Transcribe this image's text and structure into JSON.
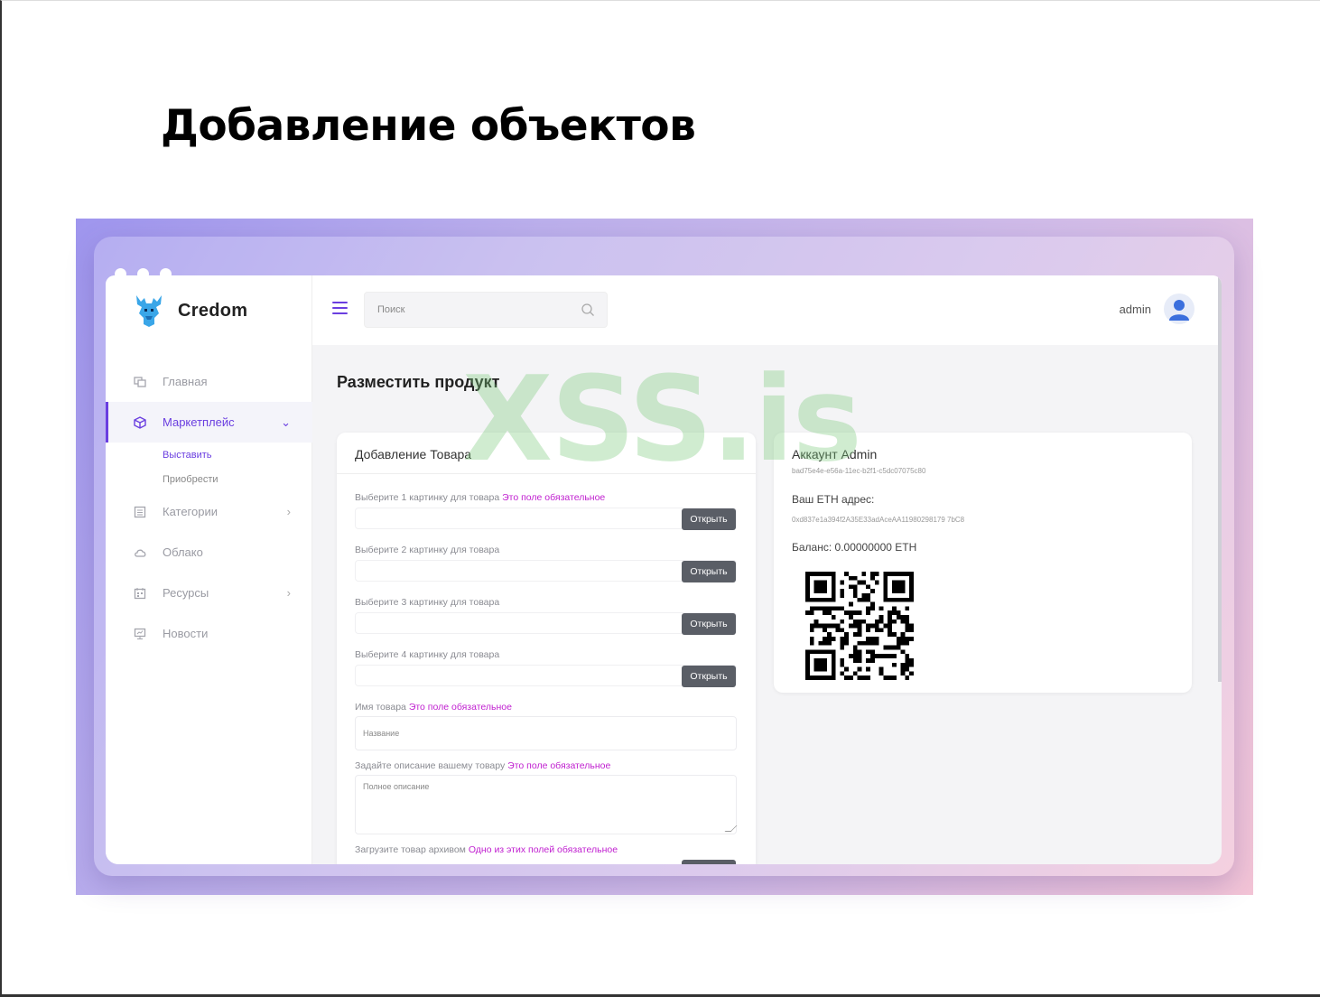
{
  "slide": {
    "title": "Добавление объектов"
  },
  "app": {
    "brand": "Credom",
    "sidebar": {
      "items": [
        {
          "label": "Главная",
          "icon": "home-icon"
        },
        {
          "label": "Маркетплейс",
          "icon": "cube-icon",
          "active": true,
          "expanded": true,
          "children": [
            {
              "label": "Выставить",
              "active": true
            },
            {
              "label": "Приобрести"
            }
          ]
        },
        {
          "label": "Категории",
          "icon": "list-icon",
          "arrow": "›"
        },
        {
          "label": "Облако",
          "icon": "cloud-icon"
        },
        {
          "label": "Ресурсы",
          "icon": "calendar-icon",
          "arrow": "›"
        },
        {
          "label": "Новости",
          "icon": "monitor-icon"
        }
      ],
      "chevron_down": "⌄"
    },
    "topbar": {
      "search_placeholder": "Поиск",
      "username": "admin"
    },
    "page_heading": "Разместить продукт",
    "product_form": {
      "title": "Добавление Товара",
      "required_note": "Это поле обязательное",
      "image_fields": [
        {
          "label": "Выберите 1 картинку для товара",
          "required": true
        },
        {
          "label": "Выберите 2 картинку для товара",
          "required": false
        },
        {
          "label": "Выберите 3 картинку для товара",
          "required": false
        },
        {
          "label": "Выберите 4 картинку для товара",
          "required": false
        }
      ],
      "open_label": "Открыть",
      "name_label": "Имя товара",
      "name_placeholder": "Название",
      "desc_label": "Задайте описание вашему товару",
      "desc_placeholder": "Полное описание",
      "archive_label": "Загрузите товар архивом",
      "archive_note": "Одно из этих полей обязательное"
    },
    "account": {
      "title": "Аккаунт Admin",
      "id": "bad75e4e-e56a-11ec-b2f1-c5dc07075c80",
      "eth_label": "Ваш ETH адрес:",
      "eth_address": "0xd837e1a394f2A35E33adAceAA11980298179 7bC8",
      "balance": "Баланс: 0.00000000 ETH"
    }
  },
  "watermark": "XSS.is",
  "colors": {
    "accent": "#6a3ee0",
    "required": "#c020d0",
    "button": "#5a5e66"
  }
}
